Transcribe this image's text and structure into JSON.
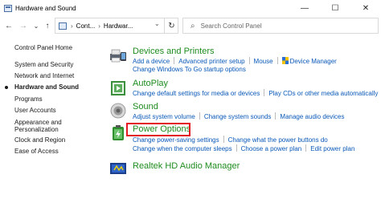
{
  "window": {
    "title": "Hardware and Sound",
    "icon": "control-panel-icon",
    "controls": {
      "minimize": "—",
      "maximize": "☐",
      "close": "✕"
    }
  },
  "address": {
    "back": "←",
    "forward": "→",
    "recent": "⌄",
    "up": "↑",
    "crumbs": [
      "Cont...",
      "Hardwar..."
    ],
    "separator": "›",
    "dropdown": "⌄",
    "refresh": "↻",
    "search_placeholder": "Search Control Panel",
    "search_icon": "⌕"
  },
  "sidebar": {
    "items": [
      {
        "label": "Control Panel Home",
        "active": false
      },
      {
        "label": "System and Security",
        "active": false
      },
      {
        "label": "Network and Internet",
        "active": false
      },
      {
        "label": "Hardware and Sound",
        "active": true
      },
      {
        "label": "Programs",
        "active": false
      },
      {
        "label": "User Accounts",
        "active": false
      },
      {
        "label": "Appearance and",
        "active": false
      },
      {
        "label": "Personalization",
        "active": false
      },
      {
        "label": "Clock and Region",
        "active": false
      },
      {
        "label": "Ease of Access",
        "active": false
      }
    ]
  },
  "categories": {
    "devices": {
      "title": "Devices and Printers",
      "icon": "printer-icon",
      "line1": [
        "Add a device",
        "Advanced printer setup",
        "Mouse",
        "Device Manager"
      ],
      "line2": [
        "Change Windows To Go startup options"
      ]
    },
    "autoplay": {
      "title": "AutoPlay",
      "icon": "autoplay-icon",
      "line1": [
        "Change default settings for media or devices",
        "Play CDs or other media automatically"
      ]
    },
    "sound": {
      "title": "Sound",
      "icon": "speaker-icon",
      "line1": [
        "Adjust system volume",
        "Change system sounds",
        "Manage audio devices"
      ]
    },
    "power": {
      "title": "Power Options",
      "icon": "battery-icon",
      "line1": [
        "Change power-saving settings",
        "Change what the power buttons do"
      ],
      "line2": [
        "Change when the computer sleeps",
        "Choose a power plan",
        "Edit power plan"
      ]
    },
    "realtek": {
      "title": "Realtek HD Audio Manager",
      "icon": "realtek-icon"
    }
  },
  "colors": {
    "title_green": "#1e8c1e",
    "link_blue": "#0a58b8",
    "highlight_red": "#e31b23"
  }
}
